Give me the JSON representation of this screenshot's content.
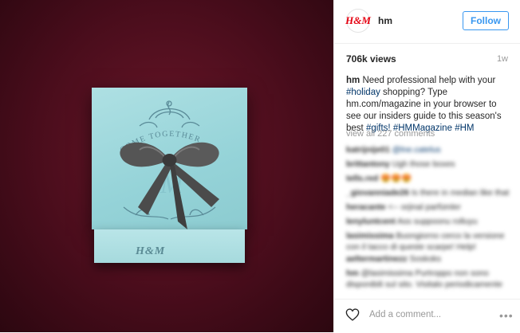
{
  "post": {
    "image": {
      "description_colors": {
        "background": "#4a0d1c",
        "box": "#9fd8dc",
        "ribbon": "#4a4a4a",
        "ornament": "#5a8b98"
      },
      "box_top_text": "COME TOGETHER",
      "box_brand": "H&M",
      "box_front_text": "H&M"
    }
  },
  "header": {
    "avatar_text": "H&M",
    "username": "hm",
    "follow_label": "Follow"
  },
  "stats": {
    "views": "706k views",
    "age": "1w"
  },
  "caption": {
    "username": "hm",
    "text_1": " Need professional help with your ",
    "tag_holiday": "#holiday",
    "text_2": " shopping? Type hm.com/magazine in your browser to see our insiders guide to this season's best ",
    "tag_gifts": "#gifts!",
    "tag_hmmagazine": "#HMMagazine",
    "tag_hm": "#HM"
  },
  "view_all_comments": "view all 227 comments",
  "comments": [
    {
      "user": "katrijnije01",
      "text": "@lne.catelus",
      "is_tag": true
    },
    {
      "user": "brittantony",
      "text": "Ugh those boxes",
      "is_tag": false
    },
    {
      "user": "tells.red",
      "text": "😍😍😍",
      "is_tag": false
    },
    {
      "user": "_giovanniade26",
      "text": "Is there in median like that",
      "is_tag": false
    },
    {
      "user": "heracante",
      "text": "<-- orjinal parfümler",
      "is_tag": false
    },
    {
      "user": "lenyluntcent",
      "text": "Ass suppoonu rolluyu",
      "is_tag": false
    },
    {
      "user": "lasimissima",
      "text": "Buongiorno cerco la versione con il tacco di queste scarpe! Help!",
      "is_tag": false
    },
    {
      "user": "aeltermartinezz",
      "text": "Soskoks",
      "is_tag": false
    },
    {
      "user": "hm",
      "text": "@lasimissima Purtroppo non sono disponibili sul sito. Visitalo periodicamente per conoscere tutte le nuove future novità.",
      "is_tag": false
    }
  ],
  "footer": {
    "heart_icon": "heart-outline-icon",
    "add_comment_placeholder": "Add a comment...",
    "more_label": "•••"
  }
}
